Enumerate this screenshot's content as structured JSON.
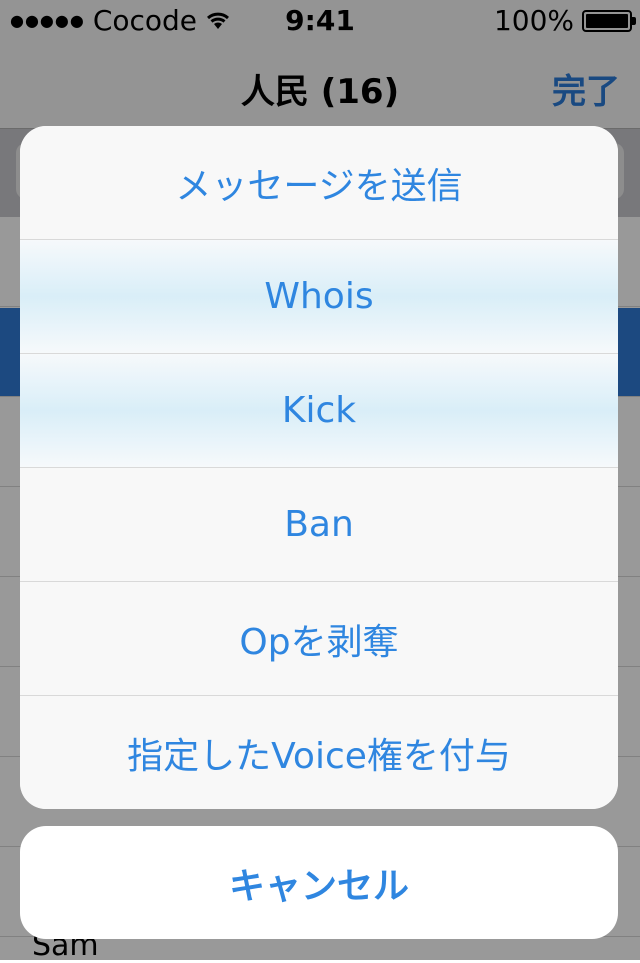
{
  "status_bar": {
    "carrier": "Cocode",
    "time": "9:41",
    "battery": "100%"
  },
  "nav": {
    "title": "人民 (16)",
    "done_label": "完了"
  },
  "list": {
    "visible_name": "Sam"
  },
  "action_sheet": {
    "items": [
      "メッセージを送信",
      "Whois",
      "Kick",
      "Ban",
      "Opを剥奪",
      "指定したVoice権を付与"
    ],
    "cancel_label": "キャンセル"
  }
}
